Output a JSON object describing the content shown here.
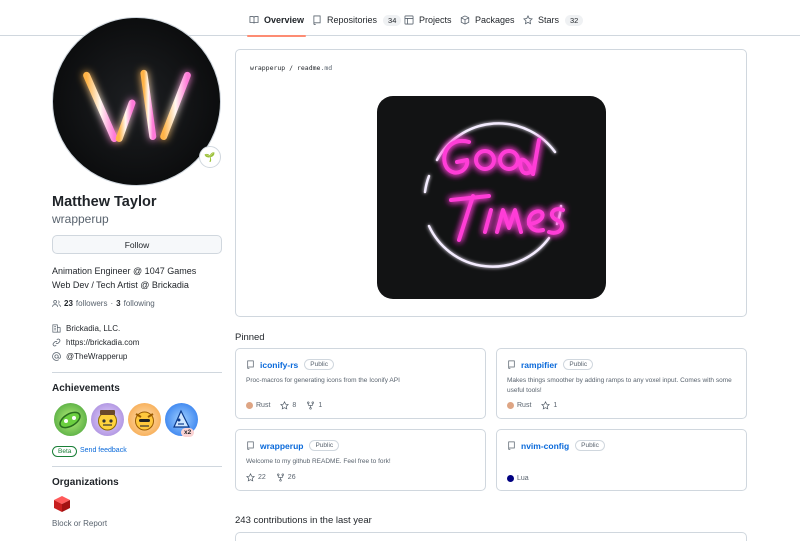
{
  "nav": {
    "tabs": [
      {
        "label": "Overview",
        "icon": "book-icon"
      },
      {
        "label": "Repositories",
        "count": "34",
        "icon": "repo-icon"
      },
      {
        "label": "Projects",
        "icon": "project-icon"
      },
      {
        "label": "Packages",
        "icon": "package-icon"
      },
      {
        "label": "Stars",
        "count": "32",
        "icon": "star-icon"
      }
    ]
  },
  "profile": {
    "full_name": "Matthew Taylor",
    "login": "wrapperup",
    "follow_label": "Follow",
    "bio_line1": "Animation Engineer @ 1047 Games",
    "bio_line2": "Web Dev / Tech Artist @ Brickadia",
    "followers_count": "23",
    "followers_label": "followers",
    "separator": "·",
    "following_count": "3",
    "following_label": "following",
    "company": "Brickadia, LLC.",
    "website": "https://brickadia.com",
    "twitter": "@TheWrapperup",
    "status_emoji": "🌱"
  },
  "achievements": {
    "heading": "Achievements",
    "multiplier": "x2",
    "beta_label": "Beta",
    "feedback_label": "Send feedback"
  },
  "organizations": {
    "heading": "Organizations",
    "block_label": "Block or Report"
  },
  "readme": {
    "path_user": "wrapperup",
    "path_sep": " / ",
    "path_file": "readme",
    "path_ext": ".md"
  },
  "pinned": {
    "heading": "Pinned",
    "repos": [
      {
        "name": "iconify-rs",
        "visibility": "Public",
        "description": "Proc-macros for generating icons from the Iconify API",
        "language": "Rust",
        "lang_color": "#dea584",
        "stars": "8",
        "forks": "1"
      },
      {
        "name": "rampifier",
        "visibility": "Public",
        "description": "Makes things smoother by adding ramps to any voxel input. Comes with some useful tools!",
        "language": "Rust",
        "lang_color": "#dea584",
        "stars": "1"
      },
      {
        "name": "wrapperup",
        "visibility": "Public",
        "description": "Welcome to my github README. Feel free to fork!",
        "stars": "22",
        "forks": "26"
      },
      {
        "name": "nvim-config",
        "visibility": "Public",
        "language": "Lua",
        "lang_color": "#000080"
      }
    ]
  },
  "contributions": {
    "heading": "243 contributions in the last year"
  }
}
